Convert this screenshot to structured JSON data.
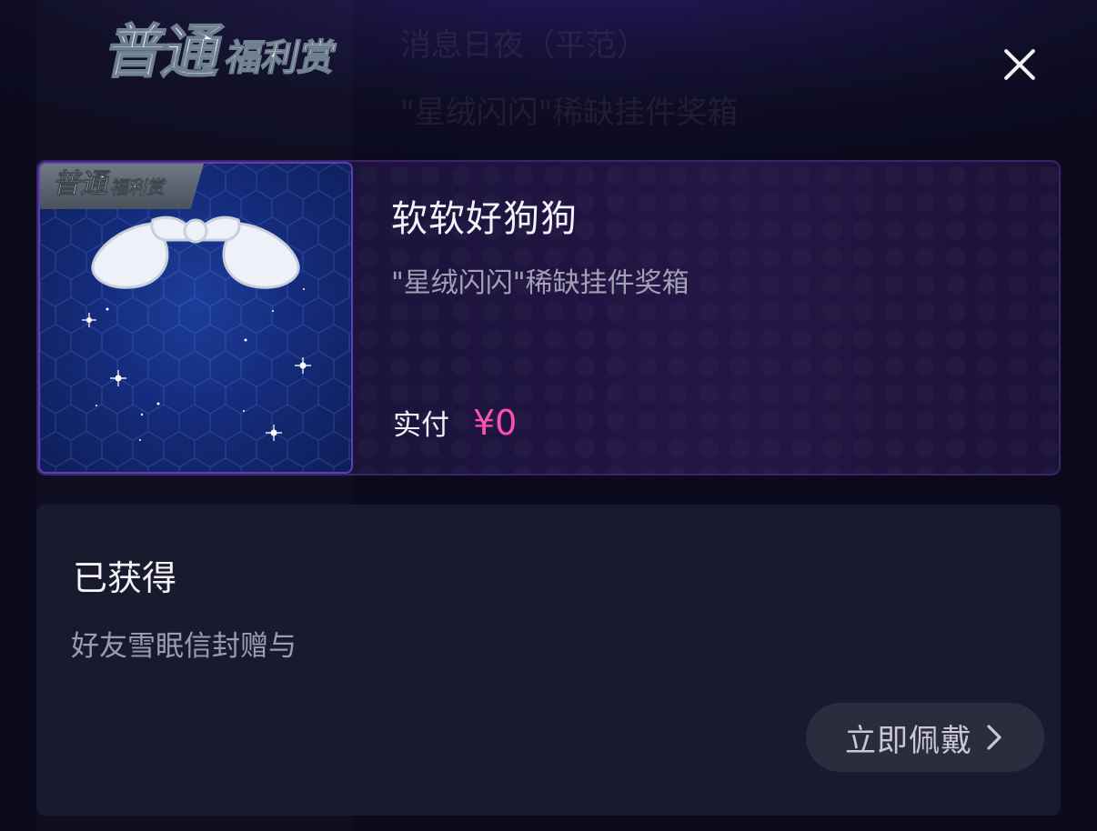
{
  "header": {
    "logo_big": "普通",
    "logo_small": "福利赏",
    "background_text": [
      "消息日夜（平范）",
      "\"星绒闪闪\"稀缺挂件奖箱"
    ],
    "close_icon": "close-icon"
  },
  "item": {
    "tag_big": "普通",
    "tag_small": "福利赏",
    "name": "软软好狗狗",
    "source": "\"星绒闪闪\"稀缺挂件奖箱",
    "price_label": "实付",
    "price_value": "¥0",
    "price_color": "#ff4fb2",
    "image_icon": "white-bow-ornament"
  },
  "info": {
    "title": "已获得",
    "description": "好友雪眠信封赠与",
    "wear_button_label": "立即佩戴",
    "wear_button_icon": "chevron-right-icon"
  }
}
